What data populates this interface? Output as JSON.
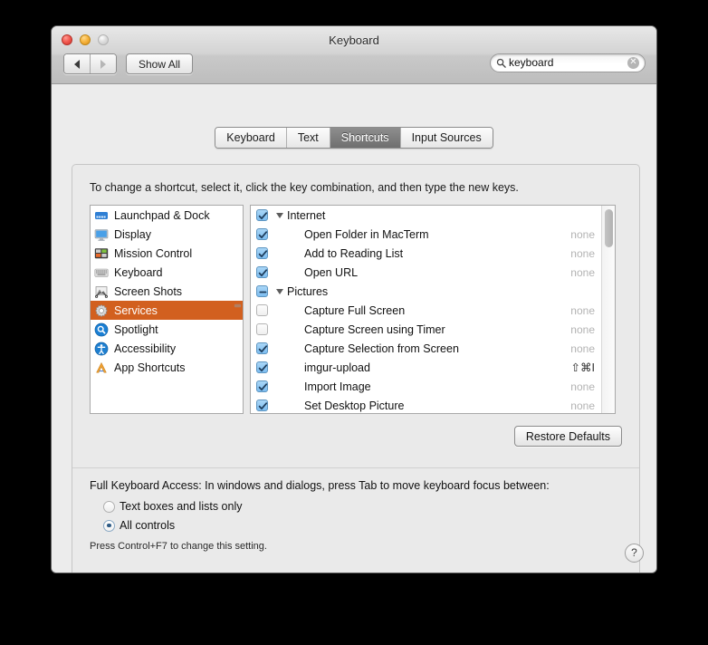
{
  "window": {
    "title": "Keyboard",
    "traffic": {
      "close": "close-button",
      "minimize": "minimize-button",
      "zoom": "zoom-button"
    }
  },
  "toolbar": {
    "back_label": "◀",
    "forward_label": "▶",
    "show_all_label": "Show All"
  },
  "search": {
    "value": "keyboard",
    "placeholder": "Search",
    "clear_label": "✕"
  },
  "tabs": [
    {
      "label": "Keyboard",
      "active": false
    },
    {
      "label": "Text",
      "active": false
    },
    {
      "label": "Shortcuts",
      "active": true
    },
    {
      "label": "Input Sources",
      "active": false
    }
  ],
  "hint": "To change a shortcut, select it, click the key combination, and then type the new keys.",
  "sidebar": {
    "items": [
      {
        "label": "Launchpad & Dock",
        "icon": "launchpad-dock-icon",
        "selected": false
      },
      {
        "label": "Display",
        "icon": "display-icon",
        "selected": false
      },
      {
        "label": "Mission Control",
        "icon": "mission-control-icon",
        "selected": false
      },
      {
        "label": "Keyboard",
        "icon": "keyboard-icon",
        "selected": false
      },
      {
        "label": "Screen Shots",
        "icon": "screen-shots-icon",
        "selected": false
      },
      {
        "label": "Services",
        "icon": "services-gear-icon",
        "selected": true
      },
      {
        "label": "Spotlight",
        "icon": "spotlight-icon",
        "selected": false
      },
      {
        "label": "Accessibility",
        "icon": "accessibility-icon",
        "selected": false
      },
      {
        "label": "App Shortcuts",
        "icon": "app-shortcuts-icon",
        "selected": false
      }
    ],
    "selection_color": "#d2601f"
  },
  "shortcuts": {
    "rows": [
      {
        "type": "group",
        "label": "Internet",
        "checked": "on",
        "expanded": true,
        "key": ""
      },
      {
        "type": "child",
        "label": "Open Folder in MacTerm",
        "checked": "on",
        "key": "none",
        "key_set": false
      },
      {
        "type": "child",
        "label": "Add to Reading List",
        "checked": "on",
        "key": "none",
        "key_set": false
      },
      {
        "type": "child",
        "label": "Open URL",
        "checked": "on",
        "key": "none",
        "key_set": false
      },
      {
        "type": "group",
        "label": "Pictures",
        "checked": "mixed",
        "expanded": true,
        "key": ""
      },
      {
        "type": "child",
        "label": "Capture Full Screen",
        "checked": "off",
        "key": "none",
        "key_set": false
      },
      {
        "type": "child",
        "label": "Capture Screen using Timer",
        "checked": "off",
        "key": "none",
        "key_set": false
      },
      {
        "type": "child",
        "label": "Capture Selection from Screen",
        "checked": "on",
        "key": "none",
        "key_set": false
      },
      {
        "type": "child",
        "label": "imgur-upload",
        "checked": "on",
        "key": "⇧⌘I",
        "key_set": true
      },
      {
        "type": "child",
        "label": "Import Image",
        "checked": "on",
        "key": "none",
        "key_set": false
      },
      {
        "type": "child",
        "label": "Set Desktop Picture",
        "checked": "on",
        "key": "none",
        "key_set": false
      }
    ],
    "scroll_position": "top"
  },
  "restore_defaults_label": "Restore Defaults",
  "full_keyboard_access": {
    "title": "Full Keyboard Access: In windows and dialogs, press Tab to move keyboard focus between:",
    "options": [
      {
        "label": "Text boxes and lists only",
        "selected": false
      },
      {
        "label": "All controls",
        "selected": true
      }
    ],
    "note": "Press Control+F7 to change this setting."
  },
  "help_label": "?"
}
